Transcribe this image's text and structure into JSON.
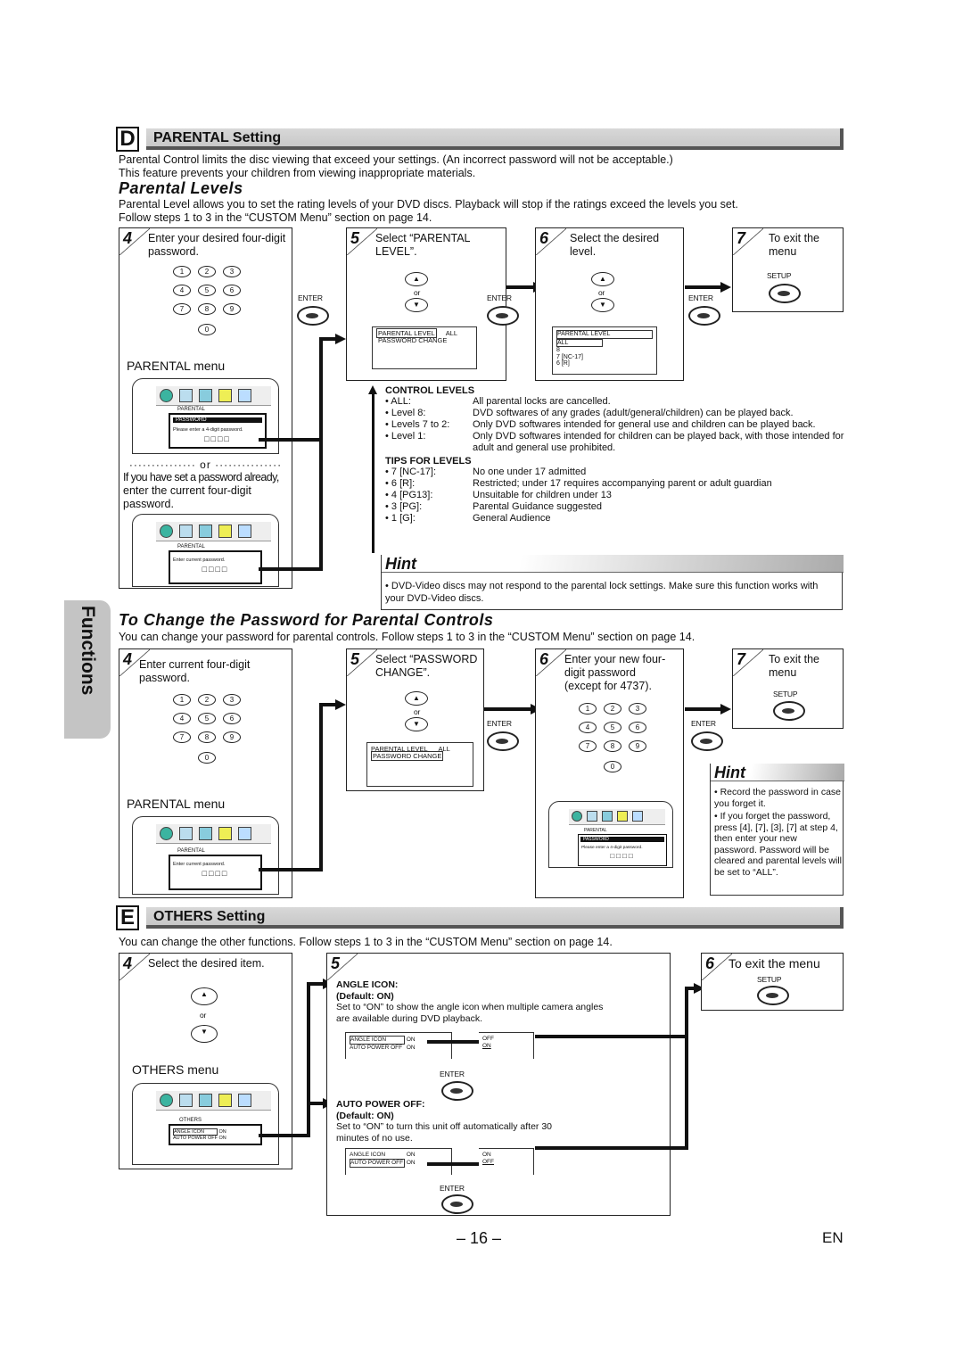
{
  "section_d": {
    "letter": "D",
    "title": "PARENTAL Setting",
    "intro": [
      "Parental Control limits the disc viewing that exceed your settings. (An incorrect password will not be acceptable.)",
      "This feature prevents your children from viewing inappropriate materials."
    ]
  },
  "parental_levels": {
    "heading": "Parental Levels",
    "intro": [
      "Parental Level allows you to set the rating levels of your DVD discs. Playback will stop if the ratings exceed the levels you set.",
      "Follow steps 1 to 3 in the “CUSTOM Menu” section on page 14."
    ],
    "step4": {
      "num": "4",
      "text": "Enter your desired four-digit password.",
      "menu_label": "PARENTAL menu",
      "or": "or",
      "alt_italic": "If you have set a password already,",
      "alt_text": "enter the current four-digit password."
    },
    "step5": {
      "num": "5",
      "text": "Select “PARENTAL LEVEL”.",
      "or": "or",
      "screen": [
        "PARENTAL LEVEL",
        "ALL",
        "PASSWORD CHANGE"
      ]
    },
    "step6": {
      "num": "6",
      "text": "Select the desired level.",
      "or": "or",
      "screen": [
        "PARENTAL LEVEL",
        "ALL",
        "8",
        "7 [NC-17]",
        "6 [R]"
      ]
    },
    "step7": {
      "num": "7",
      "text": "To exit the menu",
      "button": "SETUP"
    },
    "enter_label": "ENTER",
    "osd": {
      "tab": "PARENTAL",
      "password_bar": "PASSWORD",
      "prompt": "Please enter a 4-digit password.",
      "current_prompt": "Enter current password."
    }
  },
  "keypad": [
    "1",
    "2",
    "3",
    "4",
    "5",
    "6",
    "7",
    "8",
    "9",
    "0"
  ],
  "control_levels": {
    "heading": "CONTROL LEVELS",
    "items": [
      {
        "key": "• ALL:",
        "value": "All parental locks are cancelled."
      },
      {
        "key": "• Level 8:",
        "value": "DVD softwares of any grades (adult/general/children) can be played back."
      },
      {
        "key": "• Levels 7 to 2:",
        "value": "Only DVD softwares intended for general use and children can be played back."
      },
      {
        "key": "• Level 1:",
        "value": "Only DVD softwares intended for children can be played back, with those intended for adult and general use prohibited."
      }
    ]
  },
  "tips_for_levels": {
    "heading": "TIPS FOR LEVELS",
    "items": [
      {
        "key": "• 7 [NC-17]:",
        "value": "No one under 17 admitted"
      },
      {
        "key": "• 6 [R]:",
        "value": "Restricted; under 17 requires accompanying parent or adult guardian"
      },
      {
        "key": "• 4 [PG13]:",
        "value": "Unsuitable for children under 13"
      },
      {
        "key": "• 3 [PG]:",
        "value": "Parental Guidance suggested"
      },
      {
        "key": "• 1 [G]:",
        "value": "General Audience"
      }
    ]
  },
  "hint1": {
    "title": "Hint",
    "text": "• DVD-Video discs may not respond to the parental lock settings. Make sure this function works with your DVD-Video discs."
  },
  "change_password": {
    "heading": "To Change the Password for Parental Controls",
    "intro": "You can change your password for parental controls. Follow steps 1 to 3 in the “CUSTOM Menu” section on page 14.",
    "step4": {
      "num": "4",
      "text": "Enter current four-digit password.",
      "menu_label": "PARENTAL menu"
    },
    "step5": {
      "num": "5",
      "text": "Select “PASSWORD CHANGE”.",
      "or": "or",
      "screen": [
        "PARENTAL LEVEL",
        "ALL",
        "PASSWORD CHANGE"
      ]
    },
    "step6": {
      "num": "6",
      "text": "Enter your new four-digit password (except for 4737)."
    },
    "step7": {
      "num": "7",
      "text": "To exit the menu",
      "button": "SETUP"
    }
  },
  "hint2": {
    "title": "Hint",
    "items": [
      "• Record the password in case you forget it.",
      "• If you forget the password, press [4], [7], [3], [7] at step 4, then enter your new password. Password will be cleared and parental levels will be set to “ALL”."
    ]
  },
  "section_e": {
    "letter": "E",
    "title": "OTHERS Setting",
    "intro": "You can change the other functions. Follow steps 1 to 3 in the “CUSTOM Menu” section on page 14.",
    "step4": {
      "num": "4",
      "text": "Select the desired item.",
      "or": "or",
      "menu_label": "OTHERS menu"
    },
    "step5": {
      "num": "5"
    },
    "step6": {
      "num": "6",
      "text": "To exit the menu",
      "button": "SETUP"
    },
    "osd": {
      "tab": "OTHERS",
      "rows": [
        [
          "ANGLE ICON",
          "ON"
        ],
        [
          "AUTO POWER OFF",
          "ON"
        ]
      ]
    },
    "angle_icon": {
      "title": "ANGLE ICON:",
      "default": "(Default: ON)",
      "desc": "Set to “ON” to show the angle icon when multiple camera angles are available during DVD playback.",
      "left": [
        [
          "ANGLE ICON",
          "ON"
        ],
        [
          "AUTO POWER OFF",
          "ON"
        ]
      ],
      "right": [
        "OFF",
        "ON"
      ]
    },
    "auto_power_off": {
      "title": "AUTO POWER OFF:",
      "default": "(Default: ON)",
      "desc": "Set to “ON” to turn this unit off automatically after 30 minutes of no use.",
      "left": [
        [
          "ANGLE ICON",
          "ON"
        ],
        [
          "AUTO POWER OFF",
          "ON"
        ]
      ],
      "right": [
        "ON",
        "OFF"
      ]
    }
  },
  "side_tab": "Functions",
  "footer": {
    "page": "– 16 –",
    "lang": "EN"
  }
}
